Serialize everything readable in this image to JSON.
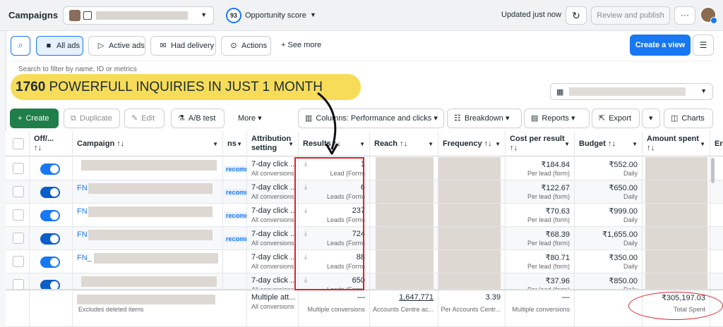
{
  "header": {
    "title": "Campaigns",
    "opportunity_score": "93",
    "opportunity_label": "Opportunity score",
    "updated": "Updated just now",
    "review_publish": "Review and publish",
    "more": "···"
  },
  "filters": {
    "all_ads": "All ads",
    "active_ads": "Active ads",
    "had_delivery": "Had delivery",
    "actions": "Actions",
    "see_more": "See more",
    "create_view": "Create a view",
    "search_placeholder": "Search to filter by name, ID or metrics"
  },
  "banner": {
    "number": "1760",
    "text": " POWERFULL INQUIRIES IN JUST 1 MONTH"
  },
  "toolbar": {
    "create": "Create",
    "duplicate": "Duplicate",
    "edit": "Edit",
    "ab_test": "A/B test",
    "more": "More",
    "columns": "Columns: Performance and clicks",
    "breakdown": "Breakdown",
    "reports": "Reports",
    "export": "Export",
    "charts": "Charts"
  },
  "columns": {
    "off_on": "Off/...",
    "sort": "↑↓",
    "campaign": "Campaign ↑↓",
    "ns": "ns",
    "attribution": "Attribution setting",
    "results": "Results ↑↓",
    "reach": "Reach ↑↓",
    "frequency": "Frequency ↑↓",
    "cost_per_result": "Cost per result",
    "budget": "Budget ↑↓",
    "amount_spent": "Amount spent",
    "edge": "Er"
  },
  "rows": [
    {
      "prefix": "",
      "recomn": "recomn",
      "attr": "7-day click ...",
      "attr_sub": "All conversions",
      "results": "1",
      "results_sub": "Lead (Form)",
      "cpr": "₹184.84",
      "cpr_sub": "Per lead (form)",
      "budget": "₹552.00",
      "budget_sub": "Daily"
    },
    {
      "prefix": "FN",
      "recomn": "recomn",
      "attr": "7-day click ...",
      "attr_sub": "All conversions",
      "results": "6",
      "results_sub": "Leads (Form)",
      "cpr": "₹122.67",
      "cpr_sub": "Per lead (form)",
      "budget": "₹650.00",
      "budget_sub": "Daily"
    },
    {
      "prefix": "FN",
      "recomn": "recomn",
      "attr": "7-day click ...",
      "attr_sub": "All conversions",
      "results": "237",
      "results_sub": "Leads (Form)",
      "cpr": "₹70.63",
      "cpr_sub": "Per lead (form)",
      "budget": "₹999.00",
      "budget_sub": "Daily"
    },
    {
      "prefix": "FN",
      "recomn": "recomn",
      "attr": "7-day click ...",
      "attr_sub": "All conversions",
      "results": "724",
      "results_sub": "Leads (Form)",
      "cpr": "₹68.39",
      "cpr_sub": "Per lead (form)",
      "budget": "₹1,655.00",
      "budget_sub": "Daily"
    },
    {
      "prefix": "FN_",
      "recomn": "",
      "attr": "7-day click ...",
      "attr_sub": "All conversions",
      "results": "88",
      "results_sub": "Leads (Form)",
      "cpr": "₹80.71",
      "cpr_sub": "Per lead (form)",
      "budget": "₹350.00",
      "budget_sub": "Daily"
    },
    {
      "prefix": "",
      "recomn": "",
      "attr": "7-day click ...",
      "attr_sub": "All conversions",
      "results": "650",
      "results_sub": "Leads (Form)",
      "cpr": "₹37.96",
      "cpr_sub": "Per lead (form)",
      "budget": "₹850.00",
      "budget_sub": "Daily"
    }
  ],
  "totals": {
    "excludes": "Excludes deleted items",
    "attr": "Multiple att...",
    "attr_sub": "All conversions",
    "results": "—",
    "results_sub": "Multiple conversions",
    "reach": "1,647,771",
    "reach_sub": "Accounts Centre ac...",
    "frequency": "3.39",
    "frequency_sub": "Per Accounts Centr...",
    "cpr": "—",
    "cpr_sub": "Multiple conversions",
    "amount": "₹305,197.03",
    "amount_sub": "Total Spent"
  },
  "colors": {
    "accent": "#1877f2",
    "create_green": "#1e7f4a",
    "banner_yellow": "#f7dc5a",
    "highlight_red": "#d8242b"
  }
}
